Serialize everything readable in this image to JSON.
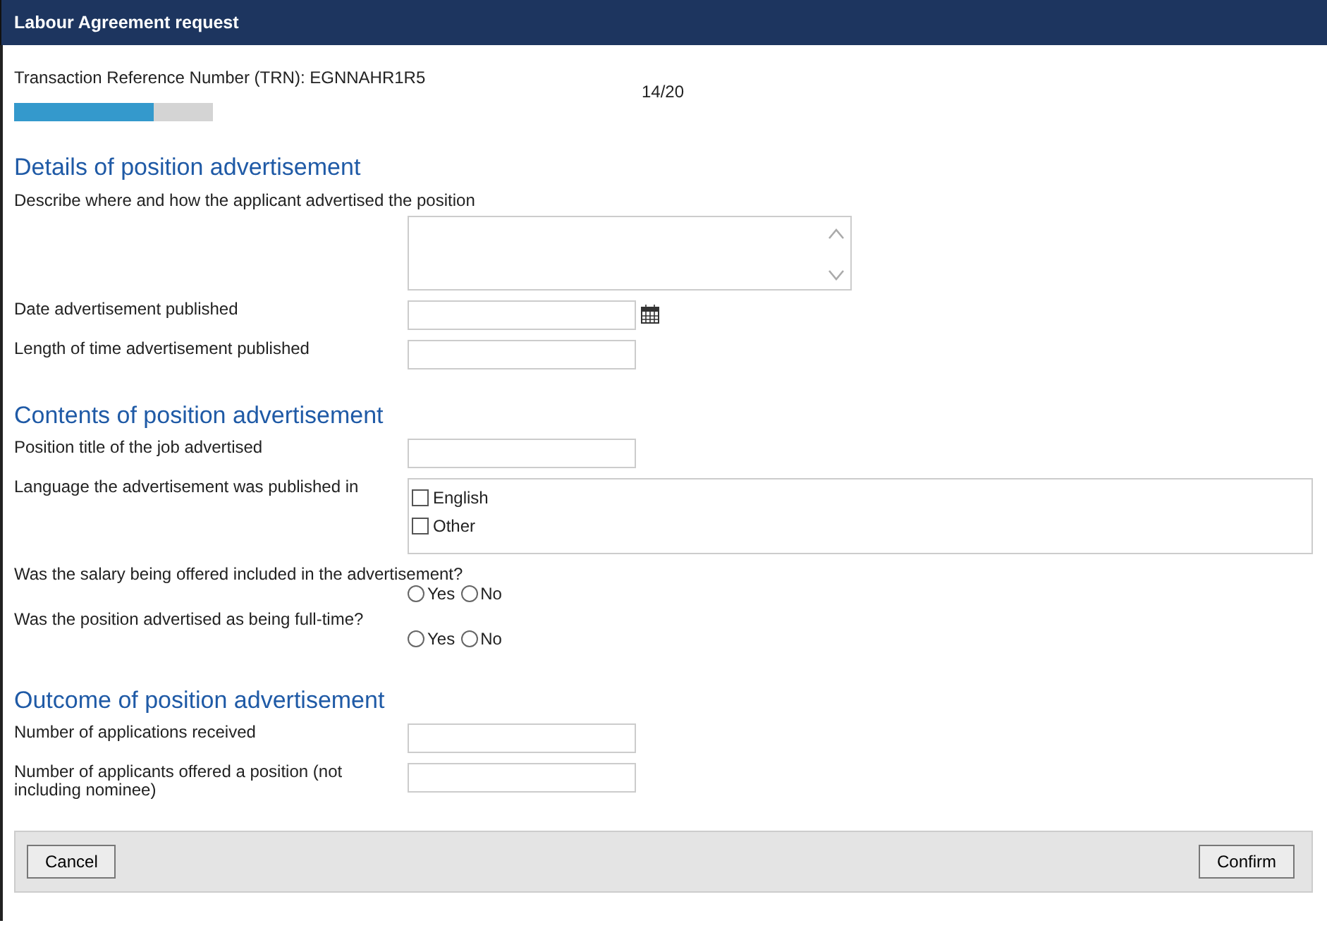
{
  "window": {
    "title": "Labour Agreement request"
  },
  "trn": "Transaction Reference Number (TRN): EGNNAHR1R5",
  "progress": {
    "level": 0.7,
    "reading": "14/20"
  },
  "sections": [
    {
      "heading": "Details of position advertisement",
      "fields": [
        {
          "kind": "textarea",
          "label": "Describe where and how the applicant advertised the position"
        },
        {
          "kind": "date",
          "label": "Date advertisement published"
        },
        {
          "kind": "text",
          "label": "Length of time advertisement published"
        }
      ]
    },
    {
      "heading": "Contents of position advertisement",
      "fields": [
        {
          "kind": "text",
          "label": "Position title of the job advertised"
        },
        {
          "kind": "checkboxes",
          "label": "Language the advertisement was published in",
          "options": [
            {
              "label": "English",
              "checked": false
            },
            {
              "label": "Other",
              "checked": false
            }
          ]
        },
        {
          "kind": "radio",
          "label": "Was the salary being offered included in the advertisement?",
          "options": [
            {
              "label": "Yes",
              "selected": false
            },
            {
              "label": "No",
              "selected": false
            }
          ]
        },
        {
          "kind": "radio",
          "label": "Was the position advertised as being full-time?",
          "options": [
            {
              "label": "Yes",
              "selected": false
            },
            {
              "label": "No",
              "selected": false
            }
          ]
        }
      ]
    },
    {
      "heading": "Outcome of position advertisement",
      "fields": [
        {
          "kind": "text",
          "label": "Number of applications received"
        },
        {
          "kind": "text",
          "label": "Number of applicants offered a position (not including nominee)"
        }
      ]
    }
  ],
  "buttons": {
    "cancel": "Cancel",
    "confirm": "Confirm"
  }
}
